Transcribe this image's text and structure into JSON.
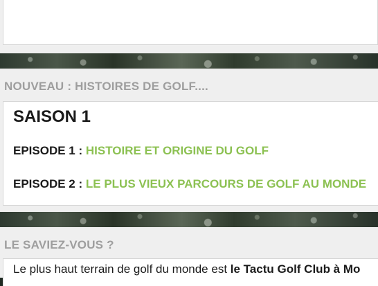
{
  "section_news": {
    "title": "NOUVEAU : HISTOIRES DE GOLF....",
    "season": "SAISON 1",
    "episodes": [
      {
        "label": "EPISODE 1 : ",
        "title": "HISTOIRE ET ORIGINE DU GOLF"
      },
      {
        "label": "EPISODE 2 : ",
        "title": "LE PLUS VIEUX PARCOURS DE GOLF AU MONDE"
      }
    ]
  },
  "section_fact": {
    "title": "LE SAVIEZ-VOUS ?",
    "text_plain": "Le plus haut terrain de golf du monde est ",
    "text_bold": "le Tactu Golf Club à Mo"
  },
  "colors": {
    "link_green": "#8cc152",
    "heading_gray": "#9e9e9e",
    "text_dark": "#1a1a1a",
    "panel_bg": "#efefef"
  }
}
